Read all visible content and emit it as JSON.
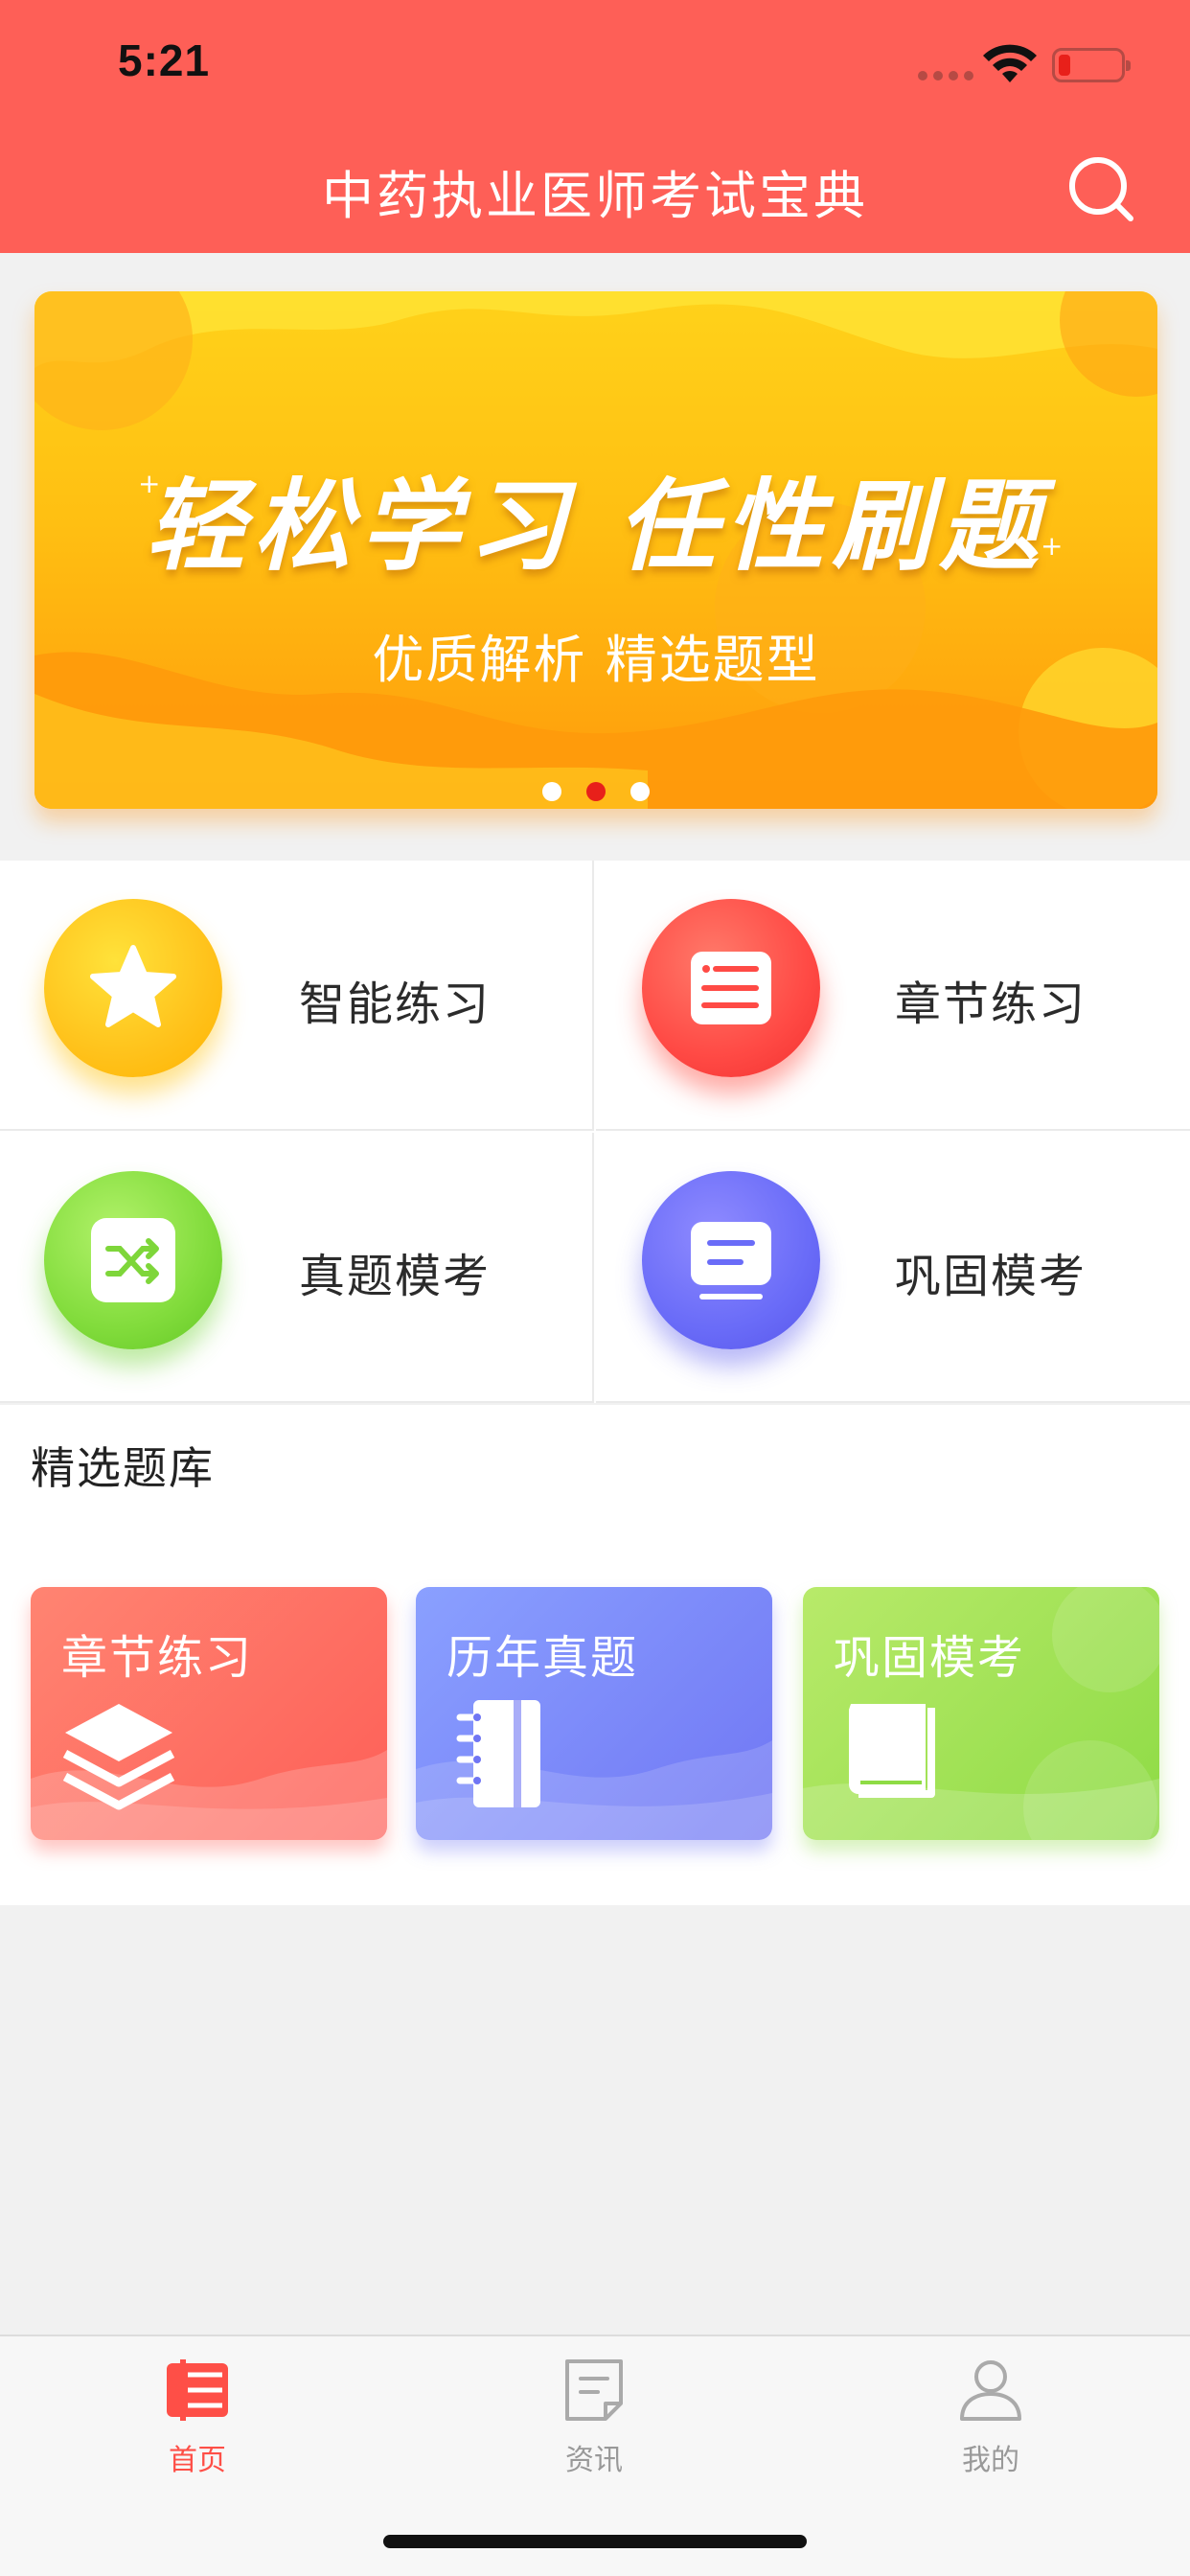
{
  "status_bar": {
    "time": "5:21"
  },
  "header": {
    "title": "中药执业医师考试宝典",
    "search_icon": "search-icon"
  },
  "banner": {
    "headline": "轻松学习 任性刷题",
    "subtitle": "优质解析 精选题型",
    "dots": 3,
    "active_dot": 2,
    "colors": {
      "top": "#ffd21a",
      "bottom": "#ff9a0b"
    }
  },
  "features": [
    {
      "label": "智能练习",
      "icon": "star-icon",
      "color": "#ffc21b"
    },
    {
      "label": "章节练习",
      "icon": "document-icon",
      "color": "#ff4a45"
    },
    {
      "label": "真题模考",
      "icon": "shuffle-icon",
      "color": "#82dc3c"
    },
    {
      "label": "巩固模考",
      "icon": "board-icon",
      "color": "#6a6cf8"
    }
  ],
  "bank": {
    "title": "精选题库",
    "cards": [
      {
        "label": "章节练习",
        "icon": "layers-icon",
        "color": "#fe5f57"
      },
      {
        "label": "历年真题",
        "icon": "notebook-icon",
        "color": "#7076f4"
      },
      {
        "label": "巩固模考",
        "icon": "book-icon",
        "color": "#8edb45"
      }
    ]
  },
  "tabbar": {
    "items": [
      {
        "label": "首页",
        "icon": "home-list-icon",
        "active": true
      },
      {
        "label": "资讯",
        "icon": "news-icon",
        "active": false
      },
      {
        "label": "我的",
        "icon": "person-icon",
        "active": false
      }
    ]
  },
  "colors": {
    "accent": "#fe5f57",
    "active_tab": "#fe4f47",
    "inactive_tab": "#999999"
  }
}
